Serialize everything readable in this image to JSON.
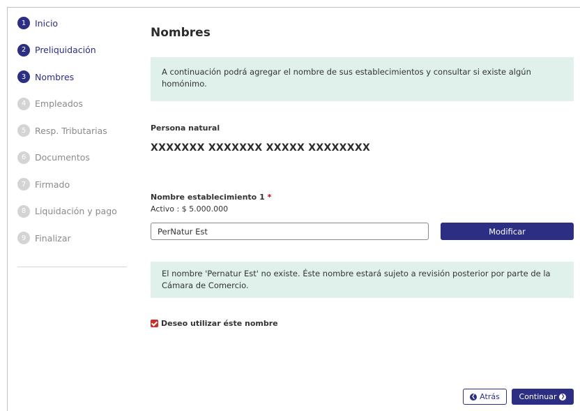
{
  "sidebar": {
    "steps": [
      {
        "number": "1",
        "label": "Inicio",
        "state": "active"
      },
      {
        "number": "2",
        "label": "Preliquidación",
        "state": "active"
      },
      {
        "number": "3",
        "label": "Nombres",
        "state": "active"
      },
      {
        "number": "4",
        "label": "Empleados",
        "state": "inactive"
      },
      {
        "number": "5",
        "label": "Resp. Tributarias",
        "state": "inactive"
      },
      {
        "number": "6",
        "label": "Documentos",
        "state": "inactive"
      },
      {
        "number": "7",
        "label": "Firmado",
        "state": "inactive"
      },
      {
        "number": "8",
        "label": "Liquidación y pago",
        "state": "inactive"
      },
      {
        "number": "9",
        "label": "Finalizar",
        "state": "inactive"
      }
    ]
  },
  "main": {
    "title": "Nombres",
    "intro_text": "A continuación podrá agregar el nombre de sus establecimientos y consultar si existe algún homónimo.",
    "persona_label": "Persona natural",
    "persona_name": "XXXXXXX XXXXXXX XXXXX XXXXXXXX",
    "field_label": "Nombre establecimiento 1",
    "required_mark": "*",
    "asset_text": "Activo : $ 5.000.000",
    "name_input_value": "PerNatur Est",
    "modify_button": "Modificar",
    "result_text": "El nombre 'Pernatur Est' no existe. Éste nombre estará sujeto a revisión posterior por parte de la Cámara de Comercio.",
    "checkbox_label": "Deseo utilizar éste nombre",
    "checkbox_checked": true,
    "back_button": "Atrás",
    "continue_button": "Continuar"
  },
  "colors": {
    "primary": "#2c2e84",
    "info_bg": "#dff1ea",
    "required": "#d0021b",
    "checkbox": "#c9302c"
  },
  "icons": {
    "back": "chevron-left-circle-icon",
    "continue": "chevron-right-circle-icon",
    "check": "check-icon"
  }
}
